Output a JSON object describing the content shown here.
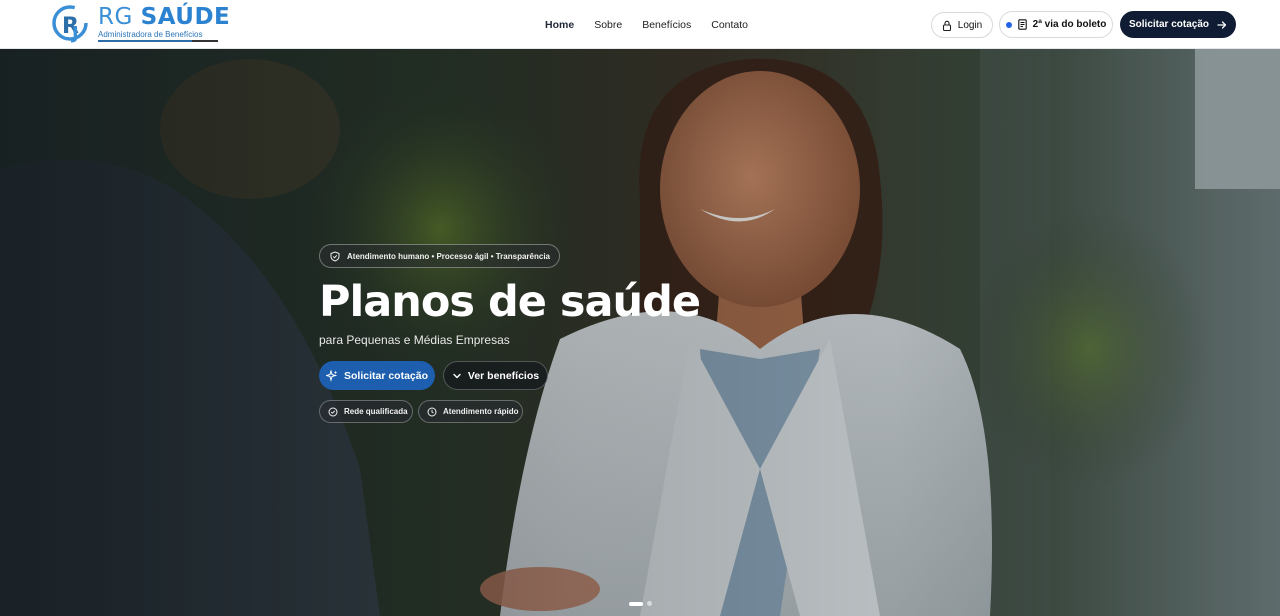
{
  "brand": {
    "title_rg": "RG",
    "title_saude": "SAÚDE",
    "subtitle": "Administradora de Benefícios"
  },
  "nav": {
    "items": [
      "Home",
      "Sobre",
      "Benefícios",
      "Contato"
    ]
  },
  "header_actions": {
    "login_label": "Login",
    "boleto_label": "2ª via do boleto",
    "cta_label": "Solicitar cotação"
  },
  "hero": {
    "tagline": "Atendimento humano • Processo ágil • Transparência",
    "title": "Planos de saúde",
    "subtitle": "para Pequenas e Médias Empresas",
    "primary_button": "Solicitar cotação",
    "secondary_button": "Ver benefícios",
    "chips": [
      "Rede qualificada",
      "Atendimento rápido"
    ]
  },
  "carousel": {
    "active_slide": 1,
    "total_slides": 2
  },
  "colors": {
    "brand_blue": "#2b82d0",
    "cta_dark": "#0f1c33",
    "hero_button_blue": "#1d5fae"
  }
}
